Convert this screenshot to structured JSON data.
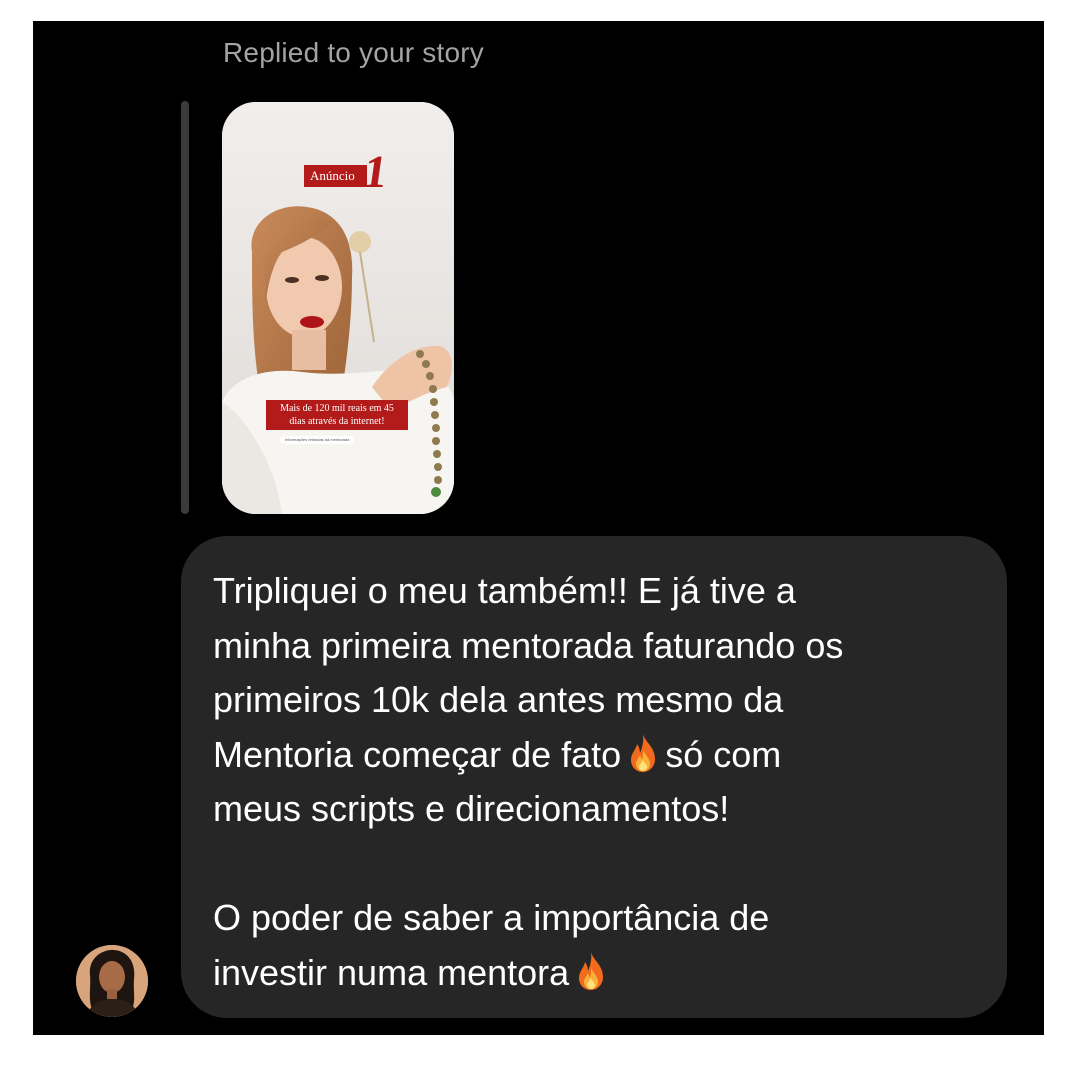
{
  "reply_caption": "Replied to your story",
  "story": {
    "badge_text": "Anúncio",
    "badge_number": "1",
    "overlay_text_line1": "Mais de 120 mil reais em 45",
    "overlay_text_line2": "dias através da internet!",
    "disclaimer": "Informações retiradas da mentorada"
  },
  "message": {
    "lines": [
      "Tripliquei o meu também!! E já tive a",
      "minha primeira mentorada faturando os",
      "primeiros 10k dela antes mesmo da",
      "Mentoria começar de fato",
      "só com",
      "meus scripts e direcionamentos!",
      "O poder de saber a importância de",
      "investir numa mentora"
    ],
    "emoji_icon": "fire-icon"
  },
  "colors": {
    "background": "#000000",
    "bubble": "#262626",
    "text": "#ffffff",
    "caption": "#a3a3a3",
    "accent_red": "#b31b1b"
  }
}
